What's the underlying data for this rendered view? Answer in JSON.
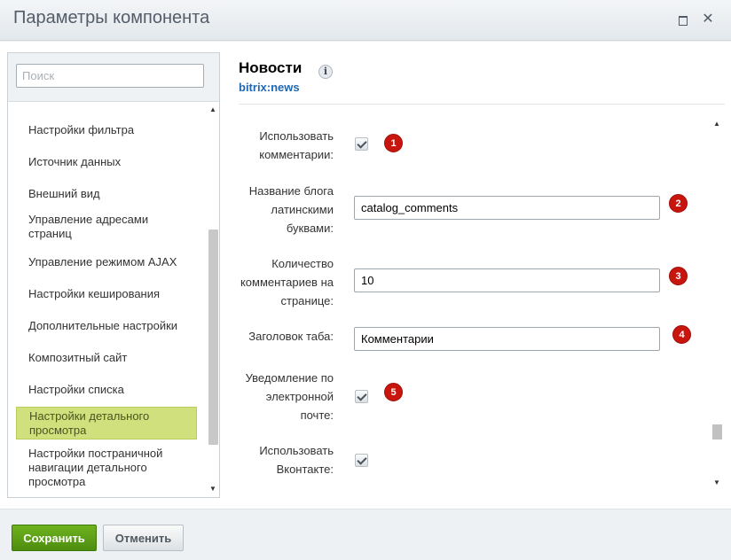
{
  "window": {
    "title": "Параметры компонента",
    "max_icon": "maximize-icon",
    "close_glyph": "✕"
  },
  "sidebar": {
    "search_placeholder": "Поиск",
    "scroll_up": "▲",
    "scroll_down": "▼",
    "items": [
      {
        "label": "Настройки фильтра",
        "active": false
      },
      {
        "label": "Источник данных",
        "active": false
      },
      {
        "label": "Внешний вид",
        "active": false
      },
      {
        "label": "Управление адресами страниц",
        "active": false
      },
      {
        "label": "Управление режимом AJAX",
        "active": false
      },
      {
        "label": "Настройки кеширования",
        "active": false
      },
      {
        "label": "Дополнительные настройки",
        "active": false
      },
      {
        "label": "Композитный сайт",
        "active": false
      },
      {
        "label": "Настройки списка",
        "active": false
      },
      {
        "label": "Настройки детального просмотра",
        "active": true
      },
      {
        "label": "Настройки постраничной навигации детального просмотра",
        "active": false
      }
    ]
  },
  "component": {
    "title": "Новости",
    "info_icon": "i",
    "code": "bitrix:news"
  },
  "form": {
    "use_comments": {
      "label": "Использовать комментарии:",
      "checked": true,
      "badge": "1"
    },
    "blog_name": {
      "label": "Название блога латинскими буквами:",
      "value": "catalog_comments",
      "badge": "2"
    },
    "comments_count": {
      "label": "Количество комментариев на странице:",
      "value": "10",
      "badge": "3"
    },
    "tab_title": {
      "label": "Заголовок таба:",
      "value": "Комментарии",
      "badge": "4"
    },
    "email_notify": {
      "label": "Уведомление по электронной почте:",
      "checked": true,
      "badge": "5"
    },
    "use_vk": {
      "label": "Использовать Вконтакте:",
      "checked": true
    }
  },
  "footer": {
    "save_label": "Сохранить",
    "cancel_label": "Отменить"
  },
  "colors": {
    "save_button": "#5a9e14",
    "active_nav": "#cfe07d",
    "badge": "#c8160f",
    "component_code": "#2067b0"
  }
}
